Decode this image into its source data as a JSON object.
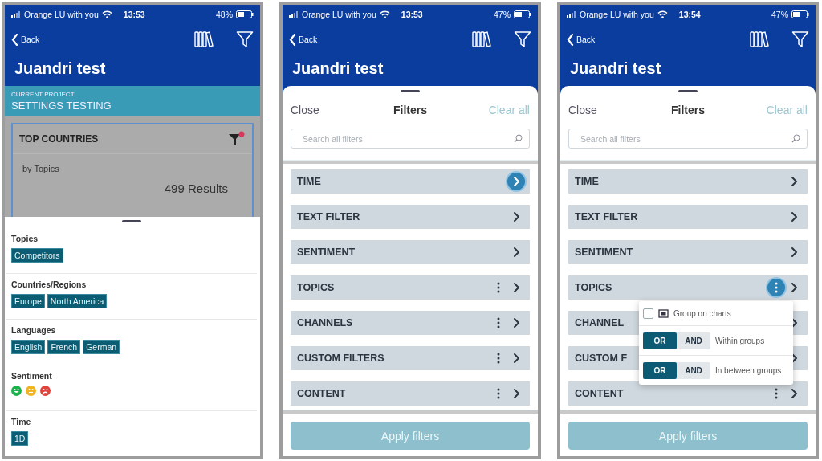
{
  "screens": [
    {
      "kind": "summary",
      "status": {
        "carrier": "Orange LU with you",
        "time": "13:53",
        "battery": "48%"
      },
      "back": "Back",
      "title": "Juandri test",
      "project": {
        "label": "CURRENT PROJECT",
        "name": "SETTINGS TESTING"
      },
      "widget": {
        "title": "TOP COUNTRIES",
        "subtitle": "by Topics",
        "results": "499 Results"
      },
      "sections": [
        {
          "heading": "Topics",
          "kind": "tags",
          "tags": [
            "Competitors"
          ]
        },
        {
          "heading": "Countries/Regions",
          "kind": "tags",
          "tags": [
            "Europe",
            "North America"
          ]
        },
        {
          "heading": "Languages",
          "kind": "tags",
          "tags": [
            "English",
            "French",
            "German"
          ]
        },
        {
          "heading": "Sentiment",
          "kind": "faces",
          "faces": [
            {
              "kind": "happy",
              "color": "#1db34c"
            },
            {
              "kind": "neutral",
              "color": "#f1b41e"
            },
            {
              "kind": "sad",
              "color": "#e2433b"
            }
          ]
        },
        {
          "heading": "Time",
          "kind": "tags",
          "tags": [
            "1D"
          ]
        }
      ]
    },
    {
      "kind": "filters",
      "status": {
        "carrier": "Orange LU with you",
        "time": "13:53",
        "battery": "47%"
      },
      "back": "Back",
      "title": "Juandri test",
      "sheet": {
        "close": "Close",
        "title": "Filters",
        "clear": "Clear all",
        "search_placeholder": "Search all filters",
        "apply": "Apply filters",
        "apply_disabled": true,
        "items": [
          {
            "label": "TIME",
            "menu": false,
            "chevron_active": true,
            "menu_active": false
          },
          {
            "label": "TEXT FILTER",
            "menu": false,
            "chevron_active": false,
            "menu_active": false
          },
          {
            "label": "SENTIMENT",
            "menu": false,
            "chevron_active": false,
            "menu_active": false
          },
          {
            "label": "TOPICS",
            "menu": true,
            "chevron_active": false,
            "menu_active": false
          },
          {
            "label": "CHANNELS",
            "menu": true,
            "chevron_active": false,
            "menu_active": false
          },
          {
            "label": "CUSTOM FILTERS",
            "menu": true,
            "chevron_active": false,
            "menu_active": false
          },
          {
            "label": "CONTENT",
            "menu": true,
            "chevron_active": false,
            "menu_active": false
          }
        ]
      }
    },
    {
      "kind": "filters",
      "status": {
        "carrier": "Orange LU with you",
        "time": "13:54",
        "battery": "47%"
      },
      "back": "Back",
      "title": "Juandri test",
      "sheet": {
        "close": "Close",
        "title": "Filters",
        "clear": "Clear all",
        "search_placeholder": "Search all filters",
        "apply": "Apply filters",
        "apply_disabled": true,
        "items": [
          {
            "label": "TIME",
            "menu": false,
            "chevron_active": false,
            "menu_active": false
          },
          {
            "label": "TEXT FILTER",
            "menu": false,
            "chevron_active": false,
            "menu_active": false
          },
          {
            "label": "SENTIMENT",
            "menu": false,
            "chevron_active": false,
            "menu_active": false
          },
          {
            "label": "TOPICS",
            "menu": true,
            "chevron_active": false,
            "menu_active": true
          },
          {
            "label": "CHANNEL",
            "menu": false,
            "chevron_active": false,
            "menu_active": false
          },
          {
            "label": "CUSTOM F",
            "menu": false,
            "chevron_active": false,
            "menu_active": false
          },
          {
            "label": "CONTENT",
            "menu": true,
            "chevron_active": false,
            "menu_active": false
          }
        ],
        "popup": {
          "checkbox": {
            "label": "Group on charts",
            "checked": false
          },
          "toggles": [
            {
              "options": [
                {
                  "label": "OR",
                  "selected": true
                },
                {
                  "label": "AND",
                  "selected": false
                }
              ],
              "label": "Within groups"
            },
            {
              "options": [
                {
                  "label": "OR",
                  "selected": true
                },
                {
                  "label": "AND",
                  "selected": false
                }
              ],
              "label": "In between groups"
            }
          ]
        }
      }
    }
  ]
}
